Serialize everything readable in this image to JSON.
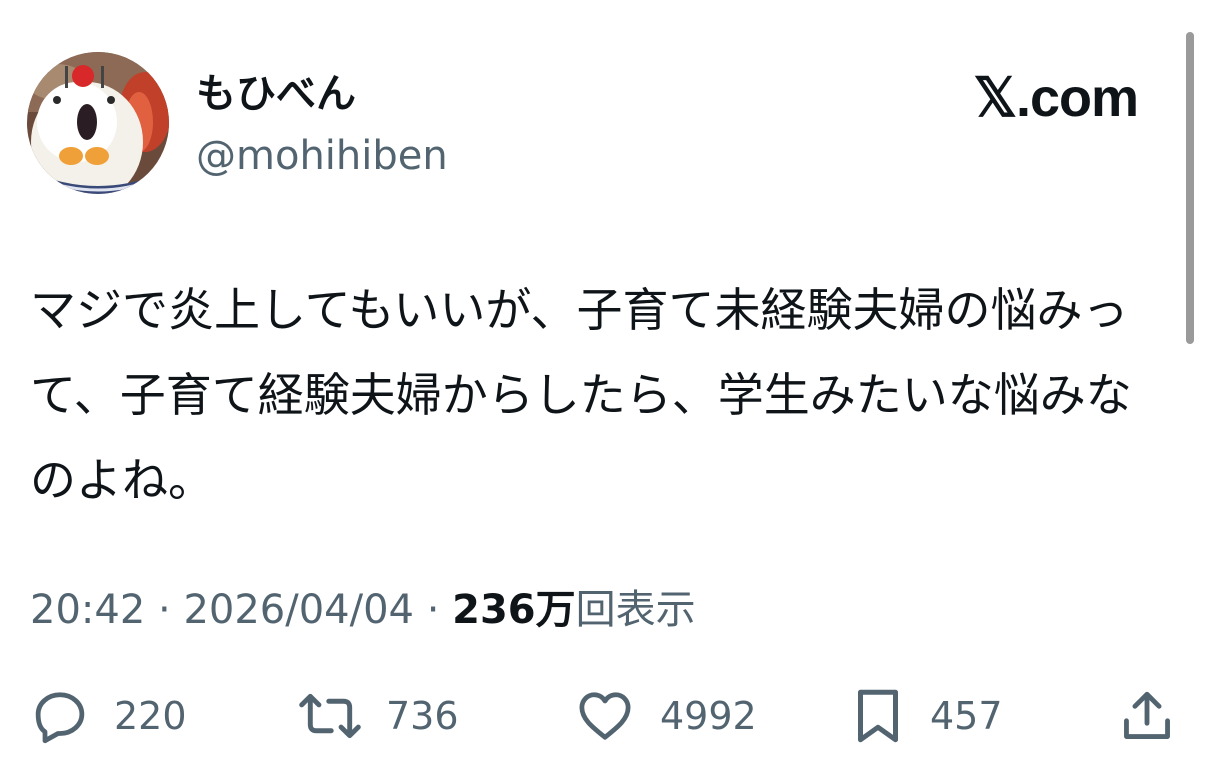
{
  "author": {
    "display_name": "もひべん",
    "handle": "@mohihiben"
  },
  "brand": "𝕏.com",
  "tweet": {
    "text": "マジで炎上してもいいが、子育て未経験夫婦の悩みって、子育て経験夫婦からしたら、学生みたいな悩みなのよね。",
    "time": "20:42",
    "separator": " · ",
    "date": "2026/04/04",
    "views_count": "236万",
    "views_label": "回表示"
  },
  "actions": {
    "replies": "220",
    "reposts": "736",
    "likes": "4992",
    "bookmarks": "457"
  },
  "icons": {
    "reply": "reply-icon",
    "repost": "repost-icon",
    "like": "heart-icon",
    "bookmark": "bookmark-icon",
    "share": "share-icon"
  },
  "colors": {
    "text": "#0f1419",
    "secondary": "#536471"
  }
}
